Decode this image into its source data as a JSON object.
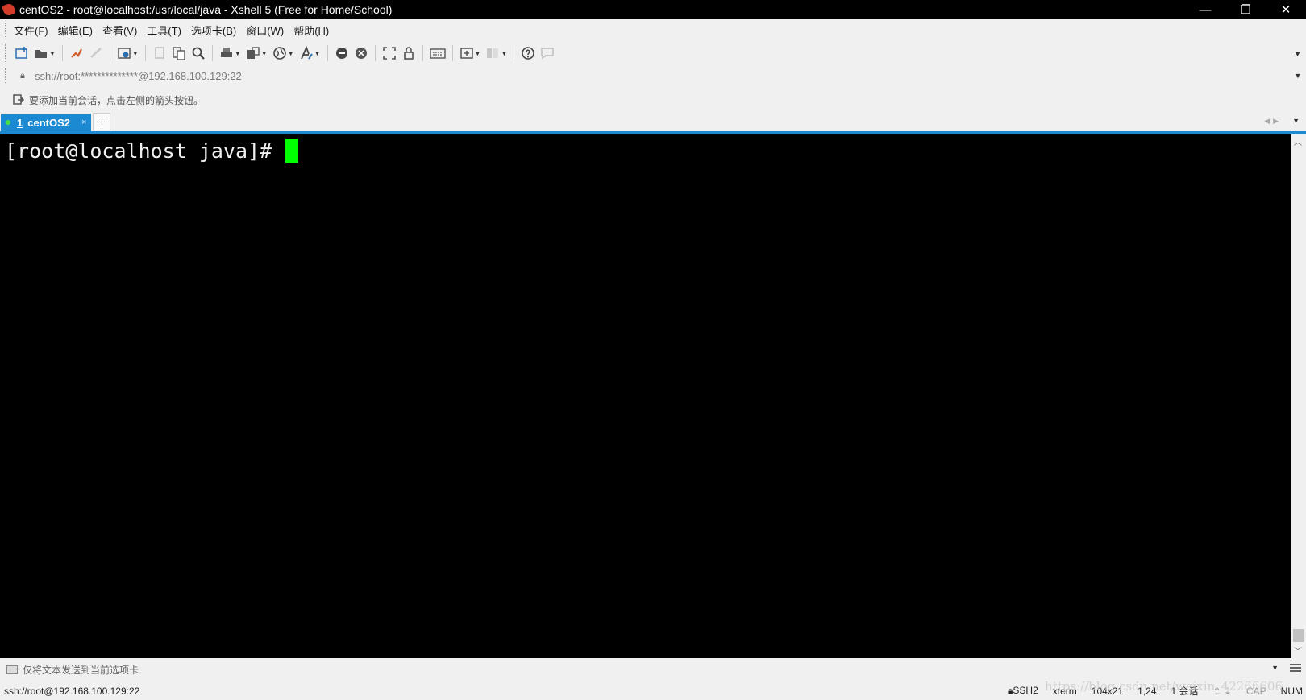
{
  "window": {
    "title": "centOS2 - root@localhost:/usr/local/java - Xshell 5 (Free for Home/School)",
    "controls": {
      "minimize": "—",
      "restore": "❐",
      "close": "✕"
    }
  },
  "menu": [
    {
      "label": "文件(F)"
    },
    {
      "label": "编辑(E)"
    },
    {
      "label": "查看(V)"
    },
    {
      "label": "工具(T)"
    },
    {
      "label": "选项卡(B)"
    },
    {
      "label": "窗口(W)"
    },
    {
      "label": "帮助(H)"
    }
  ],
  "address": {
    "value": "ssh://root:**************@192.168.100.129:22"
  },
  "hint": {
    "text": "要添加当前会话，点击左侧的箭头按钮。"
  },
  "tabs": {
    "active": {
      "number": "1",
      "label": "centOS2",
      "close": "×"
    },
    "add": "+"
  },
  "terminal": {
    "prompt": "[root@localhost java]# ",
    "background": "#000000",
    "foreground": "#f0f0f0",
    "cursor_color": "#00ff00"
  },
  "sendbar": {
    "placeholder": "仅将文本发送到当前选项卡"
  },
  "status": {
    "connection": "ssh://root@192.168.100.129:22",
    "protocol": "SSH2",
    "terminal_type": "xterm",
    "size": "104x21",
    "cursor_pos": "1,24",
    "sessions": "1 会话",
    "cap": "CAP",
    "num": "NUM"
  },
  "watermark": "https://blog.csdn.net/weixin_42266606",
  "colors": {
    "accent": "#1b8ad2",
    "titlebar": "#000000",
    "chrome": "#f0f0f0"
  }
}
